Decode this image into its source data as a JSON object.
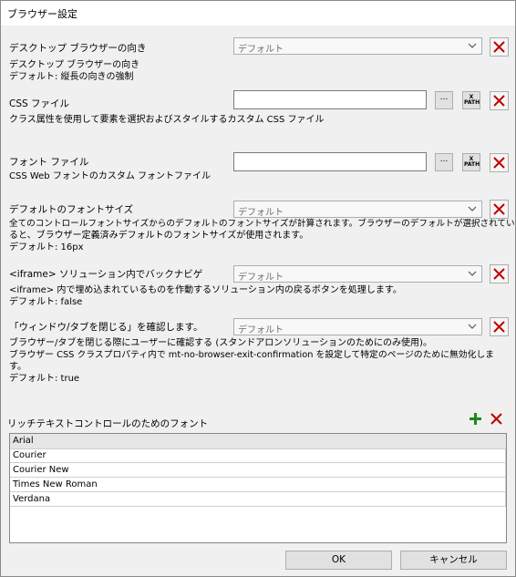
{
  "window": {
    "title": "ブラウザー設定"
  },
  "desktop_orientation": {
    "label": "デスクトップ ブラウザーの向き",
    "value": "デフォルト",
    "desc_line1": "デスクトップ ブラウザーの向き",
    "desc_line2": "デフォルト:  縦長の向きの強制"
  },
  "css_file": {
    "label": "CSS ファイル",
    "value": "",
    "browse_label": "...",
    "xpath_label_top": "X",
    "xpath_label_bottom": "PATH",
    "desc": "クラス属性を使用して要素を選択およびスタイルするカスタム CSS ファイル"
  },
  "font_file": {
    "label": "フォント ファイル",
    "value": "",
    "browse_label": "...",
    "xpath_label_top": "X",
    "xpath_label_bottom": "PATH",
    "desc": "CSS Web フォントのカスタム フォントファイル"
  },
  "default_font_size": {
    "label": "デフォルトのフォントサイズ",
    "value": "デフォルト",
    "desc_line1": "全てのコントロールフォントサイズからのデフォルトのフォントサイズが計算されます。ブラウザーのデフォルトが選択されてい",
    "desc_line2": "ると、ブラウザー定義済みデフォルトのフォントサイズが使用されます。",
    "desc_line3": "デフォルト: 16px"
  },
  "iframe_back": {
    "label": "<iframe> ソリューション内でバックナビゲ",
    "value": "デフォルト",
    "desc_line1": "<iframe> 内で埋め込まれているものを作動するソリューション内の戻るボタンを処理します。",
    "desc_line2": "デフォルト: false"
  },
  "confirm_close": {
    "label": "「ウィンドウ/タブを閉じる」を確認します。",
    "value": "デフォルト",
    "desc_line1": "ブラウザー/タブを閉じる際にユーザーに確認する (スタンドアロンソリューションのためにのみ使用)。",
    "desc_line2": "ブラウザー CSS クラスプロパティ内で mt-no-browser-exit-confirmation を設定して特定のページのために無効化しま",
    "desc_line3": "す。",
    "desc_line4": "デフォルト: true"
  },
  "rich_text_fonts": {
    "label": "リッチテキストコントロールのためのフォント",
    "header": "Arial",
    "rows": [
      "Courier",
      "Courier New",
      "Times New Roman",
      "Verdana"
    ]
  },
  "buttons": {
    "ok": "OK",
    "cancel": "キャンセル"
  },
  "colors": {
    "delete_red": "#c00000",
    "add_green": "#1a8a1a"
  }
}
